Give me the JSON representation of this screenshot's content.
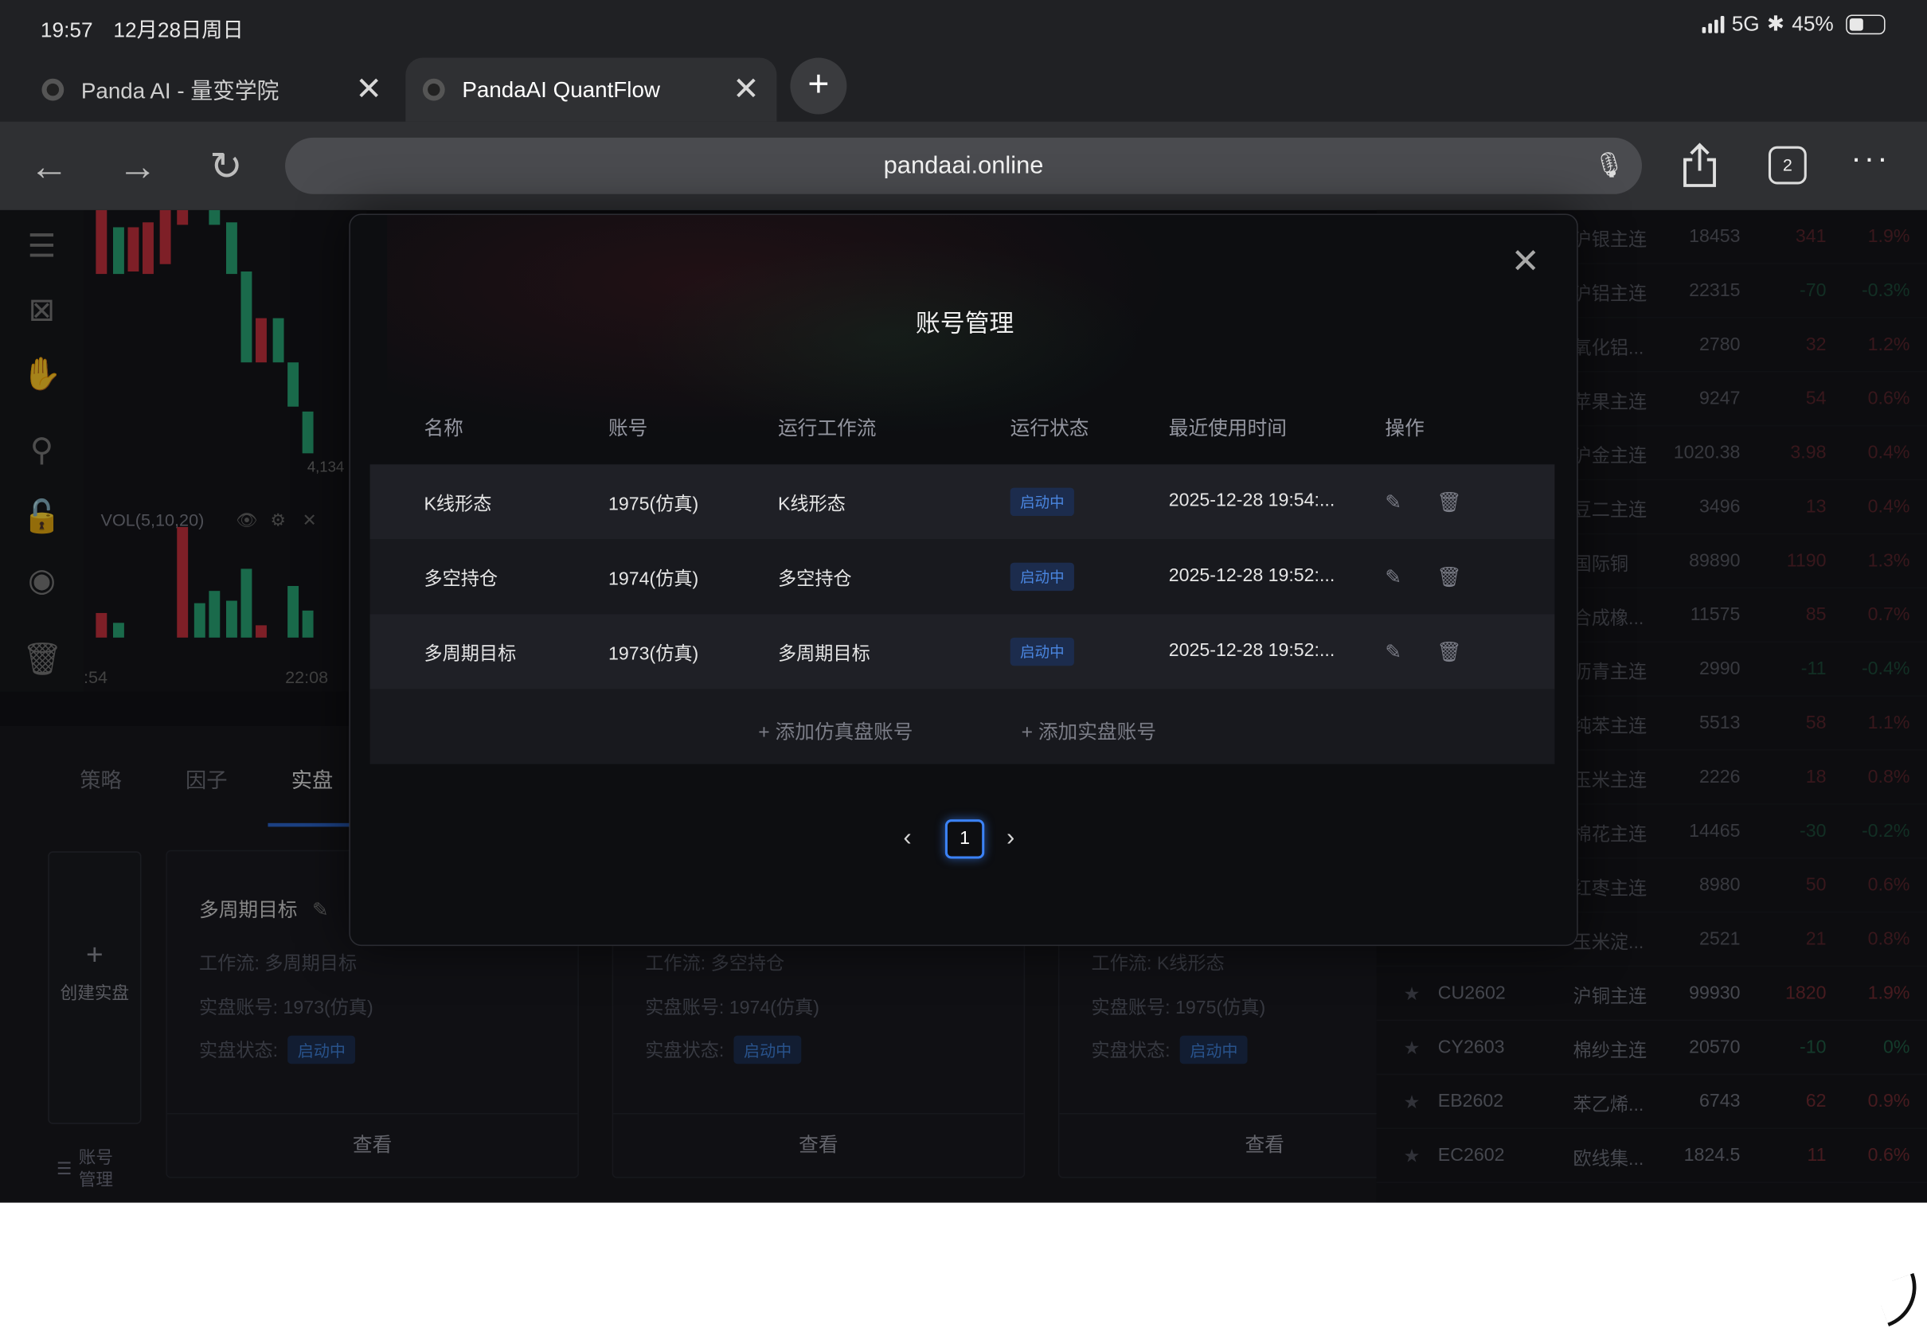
{
  "status_bar": {
    "time": "19:57",
    "date": "12月28日周日",
    "network": "5G",
    "battery": "45%"
  },
  "tabs": [
    {
      "title": "Panda AI - 量变学院"
    },
    {
      "title": "PandaAI QuantFlow"
    }
  ],
  "browser": {
    "url": "pandaai.online",
    "tab_count": "2",
    "more": "···"
  },
  "chart": {
    "price_label": "4,134",
    "indicator": "VOL(5,10,20)",
    "time_left": ":54",
    "time_right": "22:08"
  },
  "bottom": {
    "tabs": [
      "策略",
      "因子",
      "实盘"
    ],
    "create_label": "创建实盘",
    "account_manage": [
      "账号",
      "管理"
    ],
    "cards": [
      {
        "title": "多周期目标",
        "workflow": "工作流:  多周期目标",
        "account": "实盘账号:  1973(仿真)",
        "status_label": "实盘状态:",
        "status": "启动中",
        "view": "查看"
      },
      {
        "title": "",
        "workflow": "工作流:  多空持仓",
        "account": "实盘账号:  1974(仿真)",
        "status_label": "实盘状态:",
        "status": "启动中",
        "view": "查看"
      },
      {
        "title": "",
        "workflow": "工作流:  K线形态",
        "account": "实盘账号:  1975(仿真)",
        "status_label": "实盘状态:",
        "status": "启动中",
        "view": "查看"
      }
    ]
  },
  "market": {
    "rows": [
      {
        "code": "",
        "name": "沪银主连",
        "price": "18453",
        "chg": "341",
        "pct": "1.9%",
        "dir": "up"
      },
      {
        "code": "",
        "name": "沪铝主连",
        "price": "22315",
        "chg": "-70",
        "pct": "-0.3%",
        "dir": "down"
      },
      {
        "code": "",
        "name": "氧化铝...",
        "price": "2780",
        "chg": "32",
        "pct": "1.2%",
        "dir": "up"
      },
      {
        "code": "",
        "name": "苹果主连",
        "price": "9247",
        "chg": "54",
        "pct": "0.6%",
        "dir": "up"
      },
      {
        "code": "",
        "name": "沪金主连",
        "price": "1020.38",
        "chg": "3.98",
        "pct": "0.4%",
        "dir": "up"
      },
      {
        "code": "",
        "name": "豆二主连",
        "price": "3496",
        "chg": "13",
        "pct": "0.4%",
        "dir": "up"
      },
      {
        "code": "",
        "name": "国际铜",
        "price": "89890",
        "chg": "1190",
        "pct": "1.3%",
        "dir": "up"
      },
      {
        "code": "",
        "name": "合成橡...",
        "price": "11575",
        "chg": "85",
        "pct": "0.7%",
        "dir": "up"
      },
      {
        "code": "",
        "name": "沥青主连",
        "price": "2990",
        "chg": "-11",
        "pct": "-0.4%",
        "dir": "down"
      },
      {
        "code": "",
        "name": "纯苯主连",
        "price": "5513",
        "chg": "58",
        "pct": "1.1%",
        "dir": "up"
      },
      {
        "code": "",
        "name": "玉米主连",
        "price": "2226",
        "chg": "18",
        "pct": "0.8%",
        "dir": "up"
      },
      {
        "code": "",
        "name": "棉花主连",
        "price": "14465",
        "chg": "-30",
        "pct": "-0.2%",
        "dir": "down"
      },
      {
        "code": "",
        "name": "红枣主连",
        "price": "8980",
        "chg": "50",
        "pct": "0.6%",
        "dir": "up"
      },
      {
        "code": "",
        "name": "玉米淀...",
        "price": "2521",
        "chg": "21",
        "pct": "0.8%",
        "dir": "up"
      },
      {
        "code": "CU2602",
        "name": "沪铜主连",
        "price": "99930",
        "chg": "1820",
        "pct": "1.9%",
        "dir": "up"
      },
      {
        "code": "CY2603",
        "name": "棉纱主连",
        "price": "20570",
        "chg": "-10",
        "pct": "0%",
        "dir": "down"
      },
      {
        "code": "EB2602",
        "name": "苯乙烯...",
        "price": "6743",
        "chg": "62",
        "pct": "0.9%",
        "dir": "up"
      },
      {
        "code": "EC2602",
        "name": "欧线集...",
        "price": "1824.5",
        "chg": "11",
        "pct": "0.6%",
        "dir": "up"
      }
    ]
  },
  "modal": {
    "title": "账号管理",
    "columns": [
      "名称",
      "账号",
      "运行工作流",
      "运行状态",
      "最近使用时间",
      "操作"
    ],
    "rows": [
      {
        "name": "K线形态",
        "account": "1975(仿真)",
        "workflow": "K线形态",
        "status": "启动中",
        "time": "2025-12-28 19:54:..."
      },
      {
        "name": "多空持仓",
        "account": "1974(仿真)",
        "workflow": "多空持仓",
        "status": "启动中",
        "time": "2025-12-28 19:52:..."
      },
      {
        "name": "多周期目标",
        "account": "1973(仿真)",
        "workflow": "多周期目标",
        "status": "启动中",
        "time": "2025-12-28 19:52:..."
      }
    ],
    "add_sim": "+ 添加仿真盘账号",
    "add_real": "+ 添加实盘账号",
    "page": "1"
  },
  "colors": {
    "up": "#e23c4a",
    "down": "#27b07a",
    "accent": "#3b82f6",
    "tag_bg": "#1c2c4d"
  }
}
